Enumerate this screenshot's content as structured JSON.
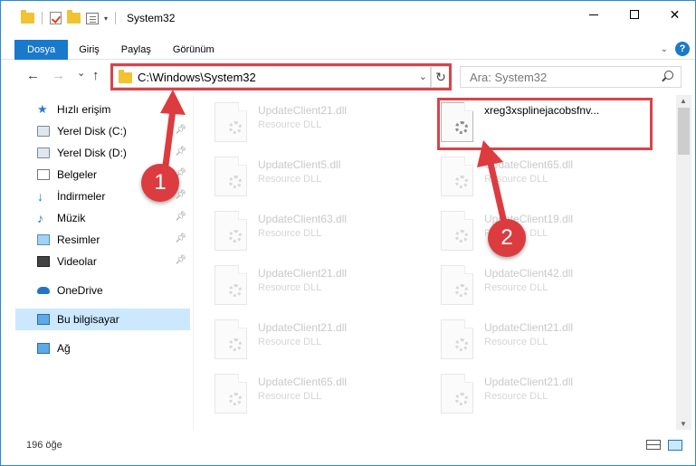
{
  "window": {
    "title": "System32",
    "controls": {
      "minimize_icon": "minimize-icon",
      "maximize_icon": "maximize-icon",
      "close_label": "✕"
    }
  },
  "ribbon": {
    "tabs": [
      "Dosya",
      "Giriş",
      "Paylaş",
      "Görünüm"
    ],
    "help_label": "?"
  },
  "nav": {
    "back_label": "←",
    "forward_label": "→",
    "recent_label": "⌄",
    "up_label": "↑",
    "address": "C:\\Windows\\System32",
    "refresh_label": "↻",
    "search_placeholder": "Ara: System32"
  },
  "sidebar": {
    "quick_access": "Hızlı erişim",
    "items": [
      {
        "label": "Yerel Disk (C:)",
        "icon": "drive-icon",
        "pinned": true
      },
      {
        "label": "Yerel Disk (D:)",
        "icon": "drive-icon",
        "pinned": true
      },
      {
        "label": "Belgeler",
        "icon": "documents-icon",
        "pinned": true
      },
      {
        "label": "İndirmeler",
        "icon": "downloads-icon",
        "pinned": true
      },
      {
        "label": "Müzik",
        "icon": "music-icon",
        "pinned": true
      },
      {
        "label": "Resimler",
        "icon": "pictures-icon",
        "pinned": true
      },
      {
        "label": "Videolar",
        "icon": "videos-icon",
        "pinned": true
      }
    ],
    "onedrive": "OneDrive",
    "this_pc": "Bu bilgisayar",
    "network": "Ağ"
  },
  "files": {
    "left_column": [
      {
        "name": "UpdateClient21.dll",
        "type": "Resource DLL"
      },
      {
        "name": "UpdateClient5.dll",
        "type": "Resource DLL"
      },
      {
        "name": "UpdateClient63.dll",
        "type": "Resource DLL"
      },
      {
        "name": "UpdateClient21.dll",
        "type": "Resource DLL"
      },
      {
        "name": "UpdateClient21.dll",
        "type": "Resource DLL"
      },
      {
        "name": "UpdateClient65.dll",
        "type": "Resource DLL"
      }
    ],
    "right_column": [
      {
        "name": "xreg3xsplinejacobsfnv...",
        "type": ""
      },
      {
        "name": "UpdateClient65.dll",
        "type": "Resource DLL"
      },
      {
        "name": "UpdateClient19.dll",
        "type": "Resource DLL"
      },
      {
        "name": "UpdateClient42.dll",
        "type": "Resource DLL"
      },
      {
        "name": "UpdateClient21.dll",
        "type": "Resource DLL"
      },
      {
        "name": "UpdateClient21.dll",
        "type": "Resource DLL"
      }
    ]
  },
  "status": {
    "item_count": "196 öğe"
  },
  "annotations": {
    "step1": "1",
    "step2": "2",
    "color": "#dc3c3f"
  }
}
